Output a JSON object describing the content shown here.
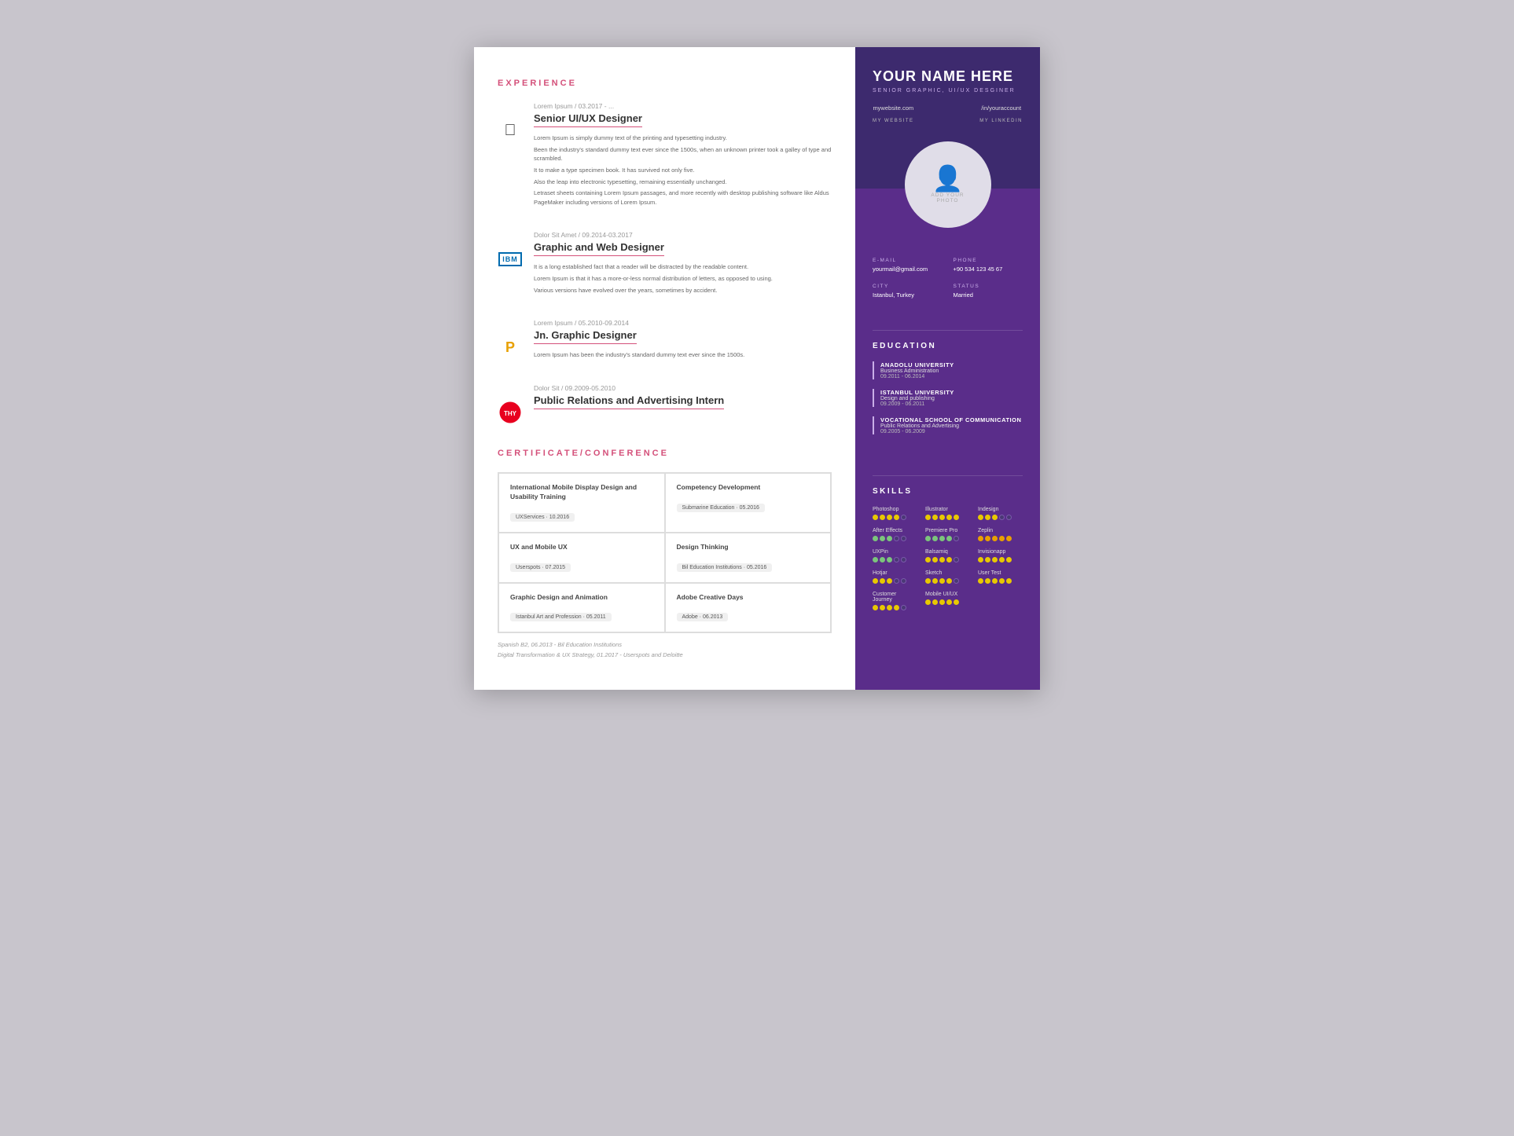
{
  "resume": {
    "left": {
      "experience": {
        "title": "EXPERIENCE",
        "items": [
          {
            "logo": "apple",
            "date": "Lorem Ipsum / 03.2017 - ...",
            "job": "Senior UI/UX Designer",
            "descriptions": [
              "Lorem Ipsum is simply dummy text of the printing and typesetting industry.",
              "Been the industry's standard dummy text ever since the 1500s, when an unknown printer took a galley of type and scrambled.",
              "It to make a type specimen book. It has survived not only five.",
              "Also the leap into electronic typesetting, remaining essentially unchanged.",
              "Letraset sheets containing Lorem Ipsum passages, and more recently with desktop publishing software like Aldus PageMaker including versions of Lorem Ipsum."
            ]
          },
          {
            "logo": "ibm",
            "date": "Dolor Sit Amet / 09.2014-03.2017",
            "job": "Graphic and Web Designer",
            "descriptions": [
              "It is a long established fact that a reader will be distracted by the readable content.",
              "Lorem Ipsum is that it has a more-or-less normal distribution of letters, as opposed to using.",
              "Various versions have evolved over the years, sometimes by accident."
            ]
          },
          {
            "logo": "p",
            "date": "Lorem Ipsum / 05.2010-09.2014",
            "job": "Jn. Graphic Designer",
            "descriptions": [
              "Lorem Ipsum has been the industry's standard dummy text ever since the 1500s."
            ]
          },
          {
            "logo": "thy",
            "date": "Dolor Sit / 09.2009-05.2010",
            "job": "Public Relations and Advertising Intern",
            "descriptions": []
          }
        ]
      },
      "certificates": {
        "title": "CERTIFICATE/CONFERENCE",
        "items": [
          {
            "name": "International Mobile Display Design and Usability Training",
            "badge": "UXServices · 10.2016",
            "accent": false
          },
          {
            "name": "Competency Development",
            "badge": "Submarine Education · 05.2016",
            "accent": false
          },
          {
            "name": "UX and Mobile UX",
            "badge": "Userspots · 07.2015",
            "accent": false
          },
          {
            "name": "Design Thinking",
            "badge": "Bil Education Institutions · 05.2016",
            "accent": false
          },
          {
            "name": "Graphic Design and Animation",
            "badge": "Istanbul Art and Profession · 05.2011",
            "accent": false
          },
          {
            "name": "Adobe Creative Days",
            "badge": "Adobe · 06.2013",
            "accent": false
          }
        ]
      },
      "languages": {
        "spanish": "Spanish B2, 06.2013",
        "spanish_inst": "- Bil Education Institutions",
        "digital": "Digital Transformation & UX Strategy, 01.2017",
        "digital_inst": "- Userspots and Deloitte"
      }
    },
    "right": {
      "name": "YOUR NAME HERE",
      "subtitle": "SENIOR GRAPHIC, UI/UX DESGINER",
      "website_url": "mywebsite.com",
      "website_label": "MY WEBSITE",
      "linkedin_url": "/in/youraccount",
      "linkedin_label": "MY LINKEDIN",
      "photo_text": "ADD YOUR\nPHOTO",
      "email_label": "E-MAIL",
      "email": "yourmail@gmail.com",
      "phone_label": "PHONE",
      "phone": "+90 534 123 45 67",
      "city_label": "CITY",
      "city": "Istanbul, Turkey",
      "status_label": "STATUS",
      "status": "Married",
      "education": {
        "title": "EDUCATION",
        "items": [
          {
            "school": "ANADOLU UNIVERSITY",
            "field": "Business Administration",
            "dates": "09.2011 - 06.2014"
          },
          {
            "school": "ISTANBUL UNIVERSITY",
            "field": "Design and publishing",
            "dates": "09.2009 - 06.2011"
          },
          {
            "school": "VOCATIONAL SCHOOL OF COMMUNICATION",
            "field": "Public Relations and Advertising",
            "dates": "09.2005 - 06.2009"
          }
        ]
      },
      "skills": {
        "title": "SKILLS",
        "items": [
          {
            "name": "Photoshop",
            "filled": 4,
            "total": 5
          },
          {
            "name": "Illustrator",
            "filled": 5,
            "total": 5
          },
          {
            "name": "Indesign",
            "filled": 3,
            "total": 5
          },
          {
            "name": "After Effects",
            "filled": 3,
            "total": 5
          },
          {
            "name": "Premiere Pro",
            "filled": 4,
            "total": 5
          },
          {
            "name": "Zeplin",
            "filled": 5,
            "total": 5
          },
          {
            "name": "UXPin",
            "filled": 3,
            "total": 5
          },
          {
            "name": "Balsamiq",
            "filled": 4,
            "total": 5
          },
          {
            "name": "Invisionapp",
            "filled": 5,
            "total": 5
          },
          {
            "name": "Hotjar",
            "filled": 3,
            "total": 5
          },
          {
            "name": "Sketch",
            "filled": 4,
            "total": 5
          },
          {
            "name": "User Test",
            "filled": 5,
            "total": 5
          },
          {
            "name": "Customer Journey",
            "filled": 4,
            "total": 5
          },
          {
            "name": "Mobile UI/UX",
            "filled": 5,
            "total": 5
          }
        ]
      }
    }
  }
}
